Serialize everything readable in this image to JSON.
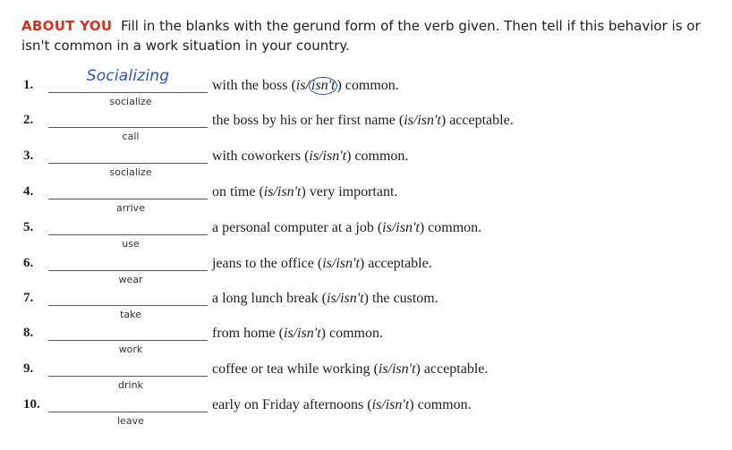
{
  "header": {
    "title": "ABOUT YOU",
    "instructions": "Fill in the blanks with the gerund form of the verb given. Then tell if this behavior is or isn't common in a work situation in your country."
  },
  "items": [
    {
      "number": "1.",
      "answer": "Socializing",
      "verb": "socialize",
      "before": "with the boss (",
      "is": "is",
      "slash": "/",
      "isnt": "isn't",
      "after": ") common.",
      "circled": "isnt"
    },
    {
      "number": "2.",
      "answer": "",
      "verb": "call",
      "before": "the boss by his or her first name (",
      "is": "is",
      "slash": "/",
      "isnt": "isn't",
      "after": ") acceptable.",
      "circled": ""
    },
    {
      "number": "3.",
      "answer": "",
      "verb": "socialize",
      "before": "with coworkers (",
      "is": "is",
      "slash": "/",
      "isnt": "isn't",
      "after": ") common.",
      "circled": ""
    },
    {
      "number": "4.",
      "answer": "",
      "verb": "arrive",
      "before": "on time (",
      "is": "is",
      "slash": "/",
      "isnt": "isn't",
      "after": ") very important.",
      "circled": ""
    },
    {
      "number": "5.",
      "answer": "",
      "verb": "use",
      "before": "a personal computer at a job (",
      "is": "is",
      "slash": "/",
      "isnt": "isn't",
      "after": ") common.",
      "circled": ""
    },
    {
      "number": "6.",
      "answer": "",
      "verb": "wear",
      "before": "jeans to the office (",
      "is": "is",
      "slash": "/",
      "isnt": "isn't",
      "after": ") acceptable.",
      "circled": ""
    },
    {
      "number": "7.",
      "answer": "",
      "verb": "take",
      "before": "a long lunch break (",
      "is": "is",
      "slash": "/",
      "isnt": "isn't",
      "after": ") the custom.",
      "circled": ""
    },
    {
      "number": "8.",
      "answer": "",
      "verb": "work",
      "before": "from home (",
      "is": "is",
      "slash": "/",
      "isnt": "isn't",
      "after": ") common.",
      "circled": ""
    },
    {
      "number": "9.",
      "answer": "",
      "verb": "drink",
      "before": "coffee or tea while working (",
      "is": "is",
      "slash": "/",
      "isnt": "isn't",
      "after": ") acceptable.",
      "circled": ""
    },
    {
      "number": "10.",
      "answer": "",
      "verb": "leave",
      "before": "early on Friday afternoons (",
      "is": "is",
      "slash": "/",
      "isnt": "isn't",
      "after": ") common.",
      "circled": ""
    }
  ],
  "colors": {
    "accent": "#d4331f",
    "handwriting": "#2d55a8"
  }
}
